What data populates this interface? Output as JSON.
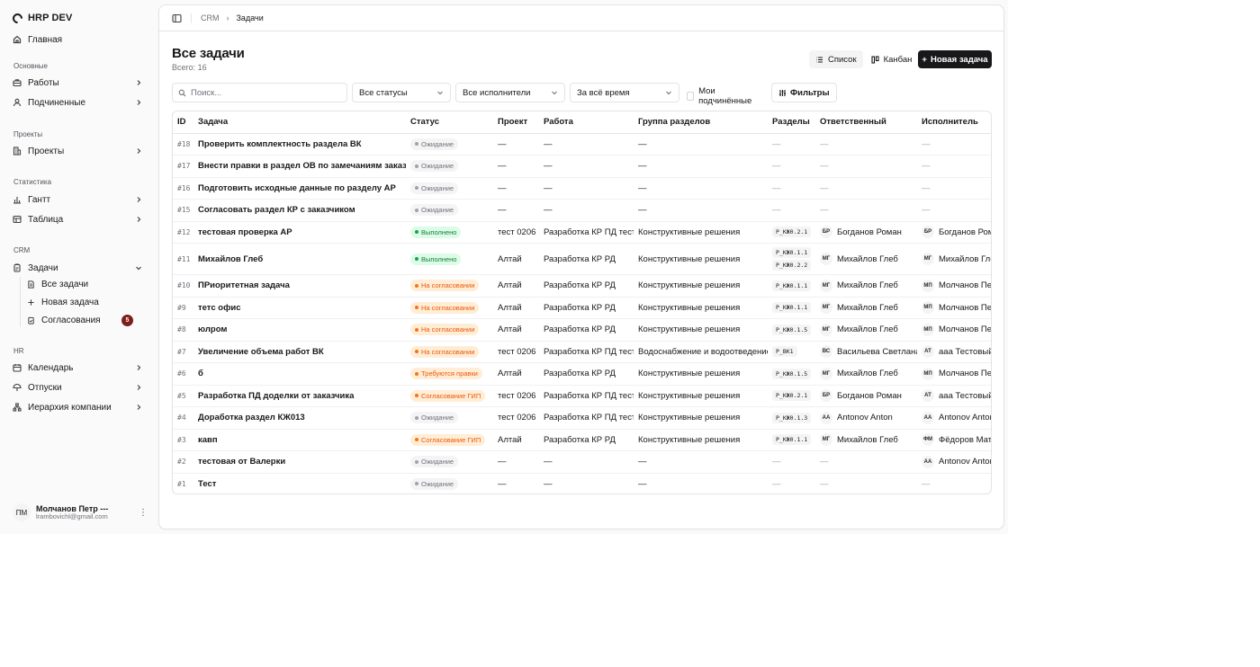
{
  "brand": {
    "name": "HRP DEV"
  },
  "sidebar": {
    "home": "Главная",
    "sections": {
      "main": "Основные",
      "projects": "Проекты",
      "stats": "Статистика",
      "crm": "CRM",
      "hr": "HR"
    },
    "items": {
      "works": "Работы",
      "subordinates": "Подчиненные",
      "projects": "Проекты",
      "gantt": "Гантт",
      "table": "Таблица",
      "tasks": "Задачи",
      "calendar": "Календарь",
      "vacations": "Отпуски",
      "hierarchy": "Иерархия компании"
    },
    "tasks_sub": {
      "all": "Все задачи",
      "new": "Новая задача",
      "approvals": "Согласования",
      "approvals_count": "5"
    },
    "user": {
      "initials": "ПМ",
      "name": "Молчанов Петр ---",
      "email": "lrambovichl@gmail.com"
    }
  },
  "breadcrumb": {
    "first": "CRM",
    "second": "Задачи"
  },
  "page": {
    "title": "Все задачи",
    "total": "Всего: 16"
  },
  "views": {
    "list": "Список",
    "kanban": "Канбан",
    "new_task": "Новая задача"
  },
  "filters": {
    "search_placeholder": "Поиск...",
    "status": "Все статусы",
    "assignee": "Все исполнители",
    "period": "За всё время",
    "my_subordinates": "Мои подчинённые",
    "filters_btn": "Фильтры"
  },
  "table": {
    "headers": [
      "ID",
      "Задача",
      "Статус",
      "Проект",
      "Работа",
      "Группа разделов",
      "Разделы",
      "Ответственный",
      "Исполнитель"
    ],
    "rows": [
      {
        "id": "#18",
        "task": "Проверить комплектность раздела ВК",
        "status": "Ожидание",
        "status_kind": "wait",
        "project": "—",
        "work": "—",
        "group": "—",
        "sections": [
          "—"
        ],
        "resp_in": "",
        "resp": "—",
        "exec_in": "",
        "exec": "—"
      },
      {
        "id": "#17",
        "task": "Внести правки в раздел ОВ по замечаниям заказчика",
        "status": "Ожидание",
        "status_kind": "wait",
        "project": "—",
        "work": "—",
        "group": "—",
        "sections": [
          "—"
        ],
        "resp_in": "",
        "resp": "—",
        "exec_in": "",
        "exec": "—"
      },
      {
        "id": "#16",
        "task": "Подготовить исходные данные по разделу АР",
        "status": "Ожидание",
        "status_kind": "wait",
        "project": "—",
        "work": "—",
        "group": "—",
        "sections": [
          "—"
        ],
        "resp_in": "",
        "resp": "—",
        "exec_in": "",
        "exec": "—"
      },
      {
        "id": "#15",
        "task": "Согласовать раздел КР с заказчиком",
        "status": "Ожидание",
        "status_kind": "wait",
        "project": "—",
        "work": "—",
        "group": "—",
        "sections": [
          "—"
        ],
        "resp_in": "",
        "resp": "—",
        "exec_in": "",
        "exec": "—"
      },
      {
        "id": "#12",
        "task": "тестовая проверка АР",
        "status": "Выполнено",
        "status_kind": "done",
        "project": "тест 0206",
        "work": "Разработка КР ПД тест",
        "group": "Конструктивные решения",
        "sections": [
          "Р_КЖ0.2.1"
        ],
        "resp_in": "БР",
        "resp": "Богданов Роман",
        "exec_in": "БР",
        "exec": "Богданов Роман"
      },
      {
        "id": "#11",
        "task": "Михайлов Глеб",
        "status": "Выполнено",
        "status_kind": "done",
        "project": "Алтай",
        "work": "Разработка КР РД",
        "group": "Конструктивные решения",
        "sections": [
          "Р_КЖ0.1.1",
          "Р_КЖ0.2.2"
        ],
        "resp_in": "МГ",
        "resp": "Михайлов Глеб",
        "exec_in": "МГ",
        "exec": "Михайлов Глеб"
      },
      {
        "id": "#10",
        "task": "ПРиоритетная задача",
        "status": "На согласовании",
        "status_kind": "appr",
        "project": "Алтай",
        "work": "Разработка КР РД",
        "group": "Конструктивные решения",
        "sections": [
          "Р_КЖ0.1.1"
        ],
        "resp_in": "МГ",
        "resp": "Михайлов Глеб",
        "exec_in": "МП",
        "exec": "Молчанов Петр"
      },
      {
        "id": "#9",
        "task": "тетс офис",
        "status": "На согласовании",
        "status_kind": "appr",
        "project": "Алтай",
        "work": "Разработка КР РД",
        "group": "Конструктивные решения",
        "sections": [
          "Р_КЖ0.1.1"
        ],
        "resp_in": "МГ",
        "resp": "Михайлов Глеб",
        "exec_in": "МП",
        "exec": "Молчанов Петр"
      },
      {
        "id": "#8",
        "task": "юлром",
        "status": "На согласовании",
        "status_kind": "appr",
        "project": "Алтай",
        "work": "Разработка КР РД",
        "group": "Конструктивные решения",
        "sections": [
          "Р_КЖ0.1.5"
        ],
        "resp_in": "МГ",
        "resp": "Михайлов Глеб",
        "exec_in": "МП",
        "exec": "Молчанов Петр"
      },
      {
        "id": "#7",
        "task": "Увеличение объема работ ВК",
        "status": "На согласовании",
        "status_kind": "appr",
        "project": "тест 0206",
        "work": "Разработка КР ПД тест",
        "group": "Водоснабжение и водоотведение",
        "sections": [
          "Р_ВК1"
        ],
        "resp_in": "ВС",
        "resp": "Васильева Светлана",
        "exec_in": "АТ",
        "exec": "ааа Тестовый"
      },
      {
        "id": "#6",
        "task": "б",
        "status": "Требуются правки",
        "status_kind": "fix",
        "project": "Алтай",
        "work": "Разработка КР РД",
        "group": "Конструктивные решения",
        "sections": [
          "Р_КЖ0.1.5"
        ],
        "resp_in": "МГ",
        "resp": "Михайлов Глеб",
        "exec_in": "МП",
        "exec": "Молчанов Петр"
      },
      {
        "id": "#5",
        "task": "Разработка ПД доделки от заказчика",
        "status": "Согласование ГИП",
        "status_kind": "gip",
        "project": "тест 0206",
        "work": "Разработка КР ПД тест",
        "group": "Конструктивные решения",
        "sections": [
          "Р_КЖ0.2.1"
        ],
        "resp_in": "БР",
        "resp": "Богданов Роман",
        "exec_in": "АТ",
        "exec": "ааа Тестовый"
      },
      {
        "id": "#4",
        "task": "Доработка раздел КЖ013",
        "status": "Ожидание",
        "status_kind": "wait",
        "project": "тест 0206",
        "work": "Разработка КР ПД тест",
        "group": "Конструктивные решения",
        "sections": [
          "Р_КЖ0.1.3"
        ],
        "resp_in": "АА",
        "resp": "Antonov Anton",
        "exec_in": "АА",
        "exec": "Antonov Anton"
      },
      {
        "id": "#3",
        "task": "кавп",
        "status": "Согласование ГИП",
        "status_kind": "gip",
        "project": "Алтай",
        "work": "Разработка КР РД",
        "group": "Конструктивные решения",
        "sections": [
          "Р_КЖ0.1.1"
        ],
        "resp_in": "МГ",
        "resp": "Михайлов Глеб",
        "exec_in": "ФМ",
        "exec": "Фёдоров Матвей"
      },
      {
        "id": "#2",
        "task": "тестовая от Валерки",
        "status": "Ожидание",
        "status_kind": "wait",
        "project": "—",
        "work": "—",
        "group": "—",
        "sections": [
          "—"
        ],
        "resp_in": "",
        "resp": "—",
        "exec_in": "АА",
        "exec": "Antonov Anton"
      },
      {
        "id": "#1",
        "task": "Тест",
        "status": "Ожидание",
        "status_kind": "wait",
        "project": "—",
        "work": "—",
        "group": "—",
        "sections": [
          "—"
        ],
        "resp_in": "",
        "resp": "—",
        "exec_in": "",
        "exec": "—"
      }
    ]
  }
}
